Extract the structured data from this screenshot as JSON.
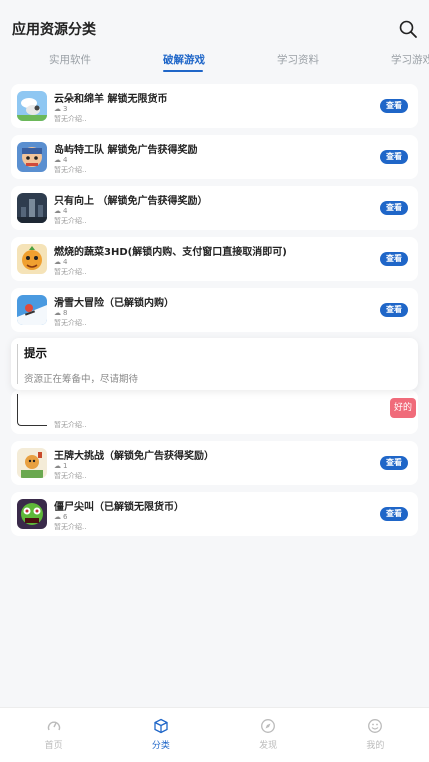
{
  "header": {
    "title": "应用资源分类"
  },
  "tabs": [
    {
      "label": "实用软件",
      "active": false
    },
    {
      "label": "破解游戏",
      "active": true
    },
    {
      "label": "学习资料",
      "active": false
    },
    {
      "label": "学习游戏",
      "active": false
    }
  ],
  "items": [
    {
      "name": "云朵和绵羊 解锁无限货币",
      "downloads": "3",
      "desc": "暂无介绍..",
      "action": "查看"
    },
    {
      "name": "岛屿特工队 解锁免广告获得奖励",
      "downloads": "4",
      "desc": "暂无介绍..",
      "action": "查看"
    },
    {
      "name": "只有向上 （解锁免广告获得奖励）",
      "downloads": "4",
      "desc": "暂无介绍..",
      "action": "查看"
    },
    {
      "name": "燃烧的蔬菜3HD(解锁内购、支付窗口直接取消即可)",
      "downloads": "4",
      "desc": "暂无介绍..",
      "action": "查看"
    },
    {
      "name": "滑雪大冒险（已解锁内购）",
      "downloads": "8",
      "desc": "暂无介绍..",
      "action": "查看"
    },
    {
      "name": "王牌大挑战（解锁免广告获得奖励）",
      "downloads": "1",
      "desc": "暂无介绍..",
      "action": "查看"
    },
    {
      "name": "僵尸尖叫（已解锁无限货币）",
      "downloads": "6",
      "desc": "暂无介绍..",
      "action": "查看"
    }
  ],
  "dialog": {
    "title": "提示",
    "message": "资源正在筹备中，尽请期待",
    "confirm": "好的"
  },
  "hidden_card": {
    "desc": "暂无介绍.."
  },
  "bottom_nav": [
    {
      "label": "首页",
      "icon": "home-icon",
      "active": false
    },
    {
      "label": "分类",
      "icon": "box-icon",
      "active": true
    },
    {
      "label": "发现",
      "icon": "compass-icon",
      "active": false
    },
    {
      "label": "我的",
      "icon": "smile-icon",
      "active": false
    }
  ],
  "colors": {
    "accent": "#1f66c8",
    "confirm": "#f06b7a"
  }
}
